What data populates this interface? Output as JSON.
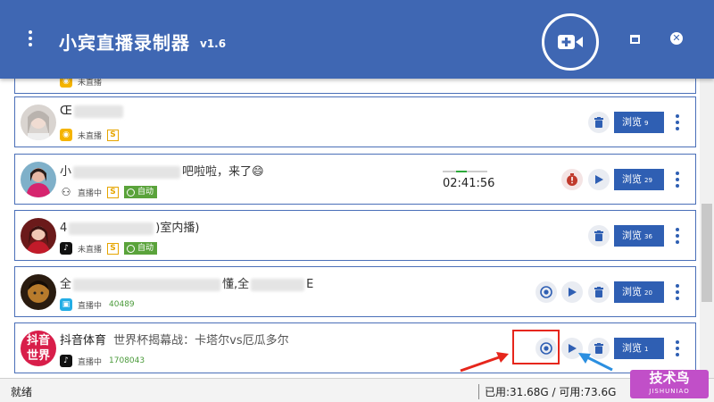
{
  "titlebar": {
    "title": "小宾直播录制器",
    "version": "v1.6"
  },
  "streams": [
    {
      "status_text": "未直播",
      "platform": "huya"
    },
    {
      "name_visible": "Œ",
      "status_text": "未直播",
      "platform": "huya",
      "badge_s": "S",
      "browse_label": "浏览",
      "browse_count": "9"
    },
    {
      "name_prefix": "小",
      "name_suffix": "吧啦啦，来了😄",
      "status_text": "直播中",
      "platform": "kuaishou",
      "badge_s": "S",
      "auto_label": "自动",
      "timer": "02:41:56",
      "browse_label": "浏览",
      "browse_count": "29"
    },
    {
      "name_prefix": "4",
      "name_suffix": ")室内播)",
      "status_text": "未直播",
      "platform": "douyin",
      "badge_s": "S",
      "auto_label": "自动",
      "browse_label": "浏览",
      "browse_count": "36"
    },
    {
      "name_prefix": "全",
      "name_middle": "懂,全",
      "name_suffix": "E",
      "status_text": "直播中",
      "platform": "bilibili",
      "viewers": "40489",
      "browse_label": "浏览",
      "browse_count": "20"
    },
    {
      "name": "抖音体育",
      "subtitle": "世界杯揭幕战：卡塔尔vs厄瓜多尔",
      "status_text": "直播中",
      "platform": "douyin",
      "viewers": "1708043",
      "browse_label": "浏览",
      "browse_count": "1",
      "avatar_text": "抖音世界"
    }
  ],
  "statusbar": {
    "ready": "就绪",
    "disk": "已用:31.68G / 可用:73.6G"
  },
  "watermark": {
    "line1": "技术鸟",
    "line2": "JISHUNIAO"
  },
  "colors": {
    "primary": "#3f67b3",
    "button_blue": "#2f5fb3",
    "live_green": "#5aa33b",
    "record_red": "#c0392b",
    "highlight_red": "#e6261c",
    "arrow_blue": "#2b8fe0"
  }
}
